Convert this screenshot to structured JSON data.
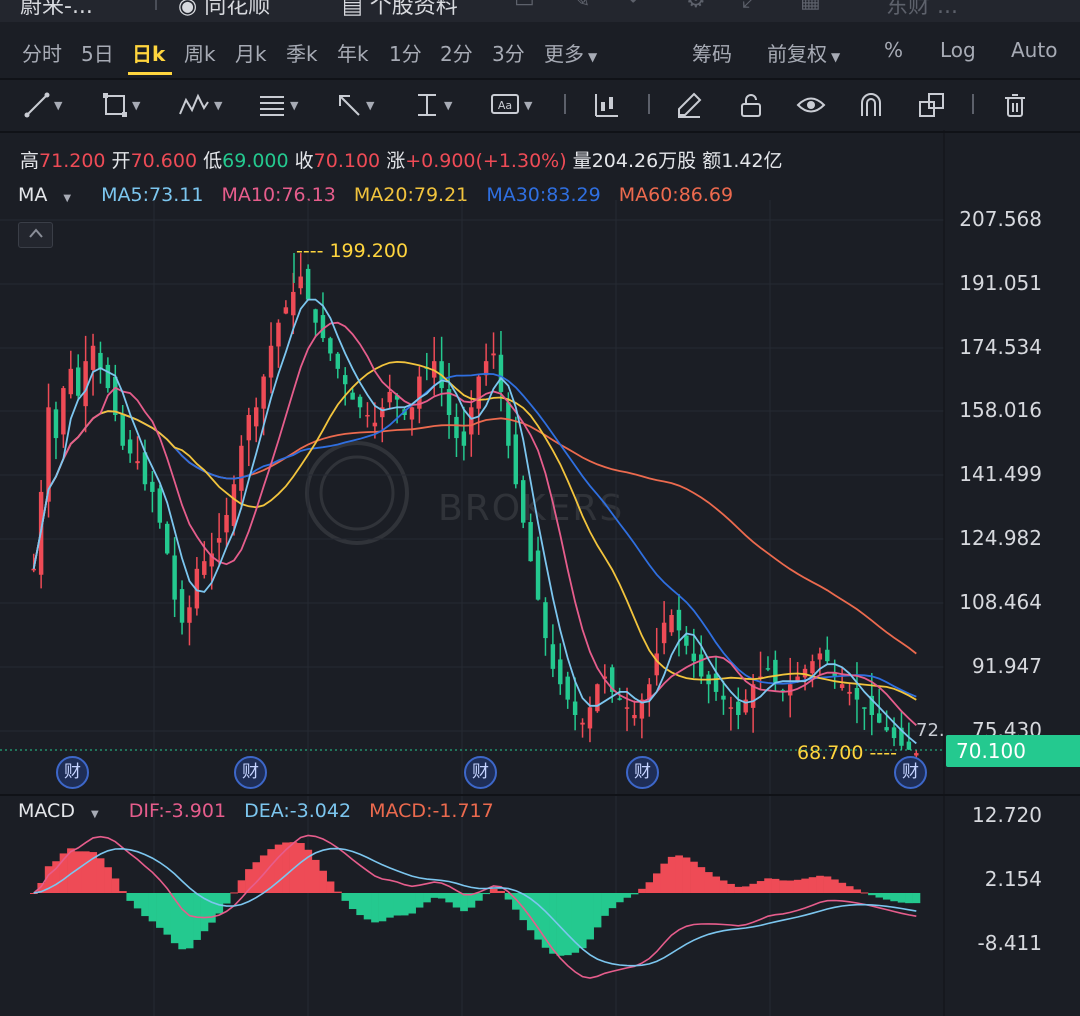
{
  "topbar": {
    "title": "蔚来-...",
    "item_a": "同花顺",
    "item_b": "个股资料",
    "item_c": "东财 ..."
  },
  "tabs": [
    {
      "label": "分时"
    },
    {
      "label": "5日"
    },
    {
      "label": "日k",
      "active": true
    },
    {
      "label": "周k"
    },
    {
      "label": "月k"
    },
    {
      "label": "季k"
    },
    {
      "label": "年k"
    },
    {
      "label": "1分"
    },
    {
      "label": "2分"
    },
    {
      "label": "3分"
    },
    {
      "label": "更多"
    }
  ],
  "right_tabs": {
    "chip": "筹码",
    "adjust": "前复权",
    "percent": "%",
    "log": "Log",
    "auto": "Auto"
  },
  "toolbar_icons": [
    "line-tool-icon",
    "rectangle-tool-icon",
    "wave-tool-icon",
    "fibonacci-tool-icon",
    "arrow-tool-icon",
    "range-tool-icon",
    "text-tool-icon",
    "candle-style-icon",
    "pencil-icon",
    "lock-icon",
    "eye-icon",
    "magnet-icon",
    "copy-icon",
    "trash-icon"
  ],
  "ohlc": {
    "high_label": "高",
    "high": "71.200",
    "open_label": "开",
    "open": "70.600",
    "low_label": "低",
    "low": "69.000",
    "close_label": "收",
    "close": "70.100",
    "change_label": "涨",
    "change": "+0.900(+1.30%)",
    "volume_label": "量",
    "volume": "204.26万股",
    "amount_label": "额",
    "amount": "1.42亿"
  },
  "ma_legend": {
    "title": "MA",
    "ma5": "MA5:73.11",
    "ma10": "MA10:76.13",
    "ma20": "MA20:79.21",
    "ma30": "MA30:83.29",
    "ma60": "MA60:86.69"
  },
  "colors": {
    "up": "#ee4b56",
    "down": "#24c98f",
    "ma5": "#7cc6ef",
    "ma10": "#e65d8c",
    "ma20": "#f2c43d",
    "ma30": "#2f6fe0",
    "ma60": "#ec6a4e",
    "accent": "#ffd53e",
    "bg": "#1b1e25"
  },
  "price_axis": [
    "207.568",
    "191.051",
    "174.534",
    "158.016",
    "141.499",
    "124.982",
    "108.464",
    "91.947",
    "75.430"
  ],
  "current_price": "70.100",
  "cut_label": "72.",
  "high_marker": "---- 199.200",
  "low_marker": "68.700 ----",
  "events_label": "财",
  "watermark": "BROKERS",
  "macd": {
    "title": "MACD",
    "dif": "DIF:-3.901",
    "dea": "DEA:-3.042",
    "macd": "MACD:-1.717",
    "axis": [
      "12.720",
      "2.154",
      "-8.411"
    ]
  },
  "chart_data": {
    "type": "candlestick",
    "y_range": [
      67,
      210
    ],
    "x_count": 120,
    "candles_close_approx": [
      118,
      138,
      160,
      152,
      165,
      170,
      163,
      172,
      176,
      170,
      165,
      158,
      150,
      148,
      146,
      140,
      138,
      130,
      122,
      110,
      104,
      108,
      118,
      120,
      122,
      126,
      132,
      140,
      150,
      158,
      160,
      168,
      176,
      182,
      186,
      190,
      194,
      188,
      182,
      178,
      174,
      170,
      166,
      162,
      160,
      158,
      156,
      160,
      164,
      162,
      158,
      160,
      168,
      170,
      172,
      165,
      158,
      152,
      150,
      160,
      168,
      172,
      174,
      164,
      150,
      140,
      130,
      120,
      110,
      100,
      92,
      88,
      84,
      80,
      78,
      82,
      88,
      90,
      86,
      84,
      82,
      80,
      84,
      88,
      96,
      104,
      106,
      102,
      98,
      94,
      90,
      88,
      86,
      84,
      82,
      80,
      84,
      88,
      90,
      92,
      88,
      86,
      88,
      90,
      92,
      94,
      96,
      94,
      90,
      88,
      86,
      84,
      82,
      80,
      78,
      76,
      74,
      72,
      71,
      70.1
    ],
    "ma": {
      "MA5": "73.11",
      "MA10": "76.13",
      "MA20": "79.21",
      "MA30": "83.29",
      "MA60": "86.69"
    },
    "marked_high": 199.2,
    "marked_low": 68.7,
    "last_close": 70.1
  }
}
